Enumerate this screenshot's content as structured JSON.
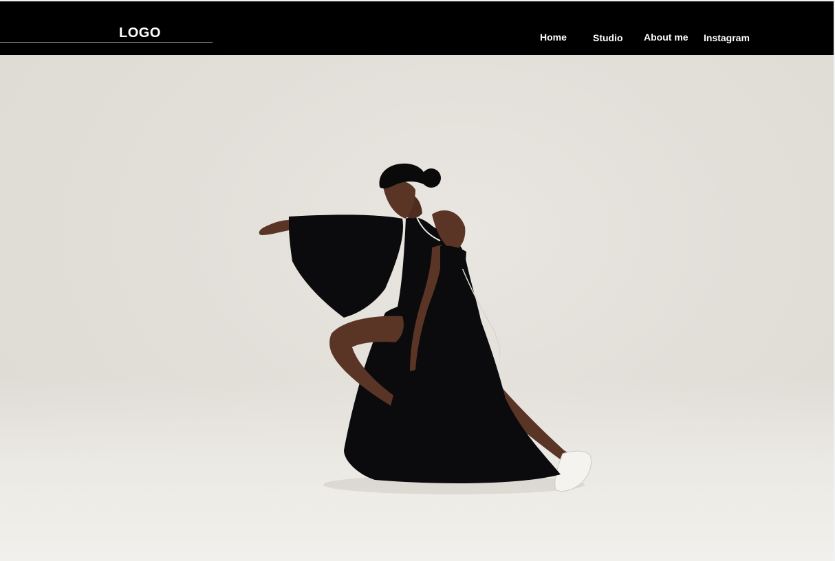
{
  "header": {
    "logo": "LOGO",
    "nav": [
      {
        "label": "Home"
      },
      {
        "label": "Studio"
      },
      {
        "label": "About me"
      },
      {
        "label": "Instagram"
      }
    ]
  },
  "colors": {
    "header_bg": "#000000",
    "nav_text": "#ffffff",
    "backdrop": "#e2ded8",
    "dress": "#0b0b0d",
    "skin": "#5a3526"
  },
  "hero": {
    "image": "dancer-photo"
  }
}
